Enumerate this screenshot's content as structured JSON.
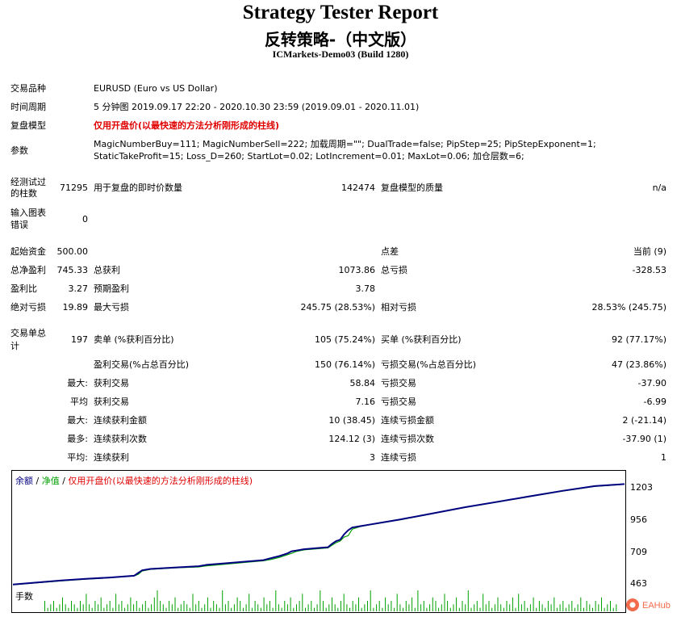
{
  "header": {
    "title": "Strategy Tester Report",
    "subtitle": "反转策略-（中文版）",
    "server": "ICMarkets-Demo03 (Build 1280)"
  },
  "settings": {
    "symbol_label": "交易品种",
    "symbol_value": "EURUSD (Euro vs US Dollar)",
    "period_label": "时间周期",
    "period_value": "5 分钟图 2019.09.17 22:20 - 2020.10.30 23:59 (2019.09.01 - 2020.11.01)",
    "model_label": "复盘模型",
    "model_value": "仅用开盘价(以最快速的方法分析刚形成的柱线)",
    "params_label": "参数",
    "params_line1": "MagicNumberBuy=111; MagicNumberSell=222; 加载周期=\"\"; DualTrade=false; PipStep=25; PipStepExponent=1;",
    "params_line2": "StaticTakeProfit=15; Loss_D=260; StartLot=0.02; LotIncrement=0.01; MaxLot=0.06; 加仓层数=6;"
  },
  "test_info": {
    "bars_label_1": "经测试过",
    "bars_label_2": "的柱数",
    "bars_value": "71295",
    "ticks_label": "用于复盘的即时价数量",
    "ticks_value": "142474",
    "quality_label": "复盘模型的质量",
    "quality_value": "n/a",
    "errors_label_1": "输入图表",
    "errors_label_2": "错误",
    "errors_value": "0"
  },
  "results": {
    "initial_deposit_label": "起始资金",
    "initial_deposit_value": "500.00",
    "spread_label": "点差",
    "spread_value": "当前 (9)",
    "net_profit_label": "总净盈利",
    "net_profit_value": "745.33",
    "gross_profit_label": "总获利",
    "gross_profit_value": "1073.86",
    "gross_loss_label": "总亏损",
    "gross_loss_value": "-328.53",
    "profit_factor_label": "盈利比",
    "profit_factor_value": "3.27",
    "expected_payoff_label": "预期盈利",
    "expected_payoff_value": "3.78",
    "abs_drawdown_label": "绝对亏损",
    "abs_drawdown_value": "19.89",
    "max_drawdown_label": "最大亏损",
    "max_drawdown_value": "245.75 (28.53%)",
    "rel_drawdown_label": "相对亏损",
    "rel_drawdown_value": "28.53% (245.75)"
  },
  "trades": {
    "total_label_1": "交易单总",
    "total_label_2": "计",
    "total_value": "197",
    "short_label": "卖单 (%获利百分比)",
    "short_value": "105 (75.24%)",
    "long_label": "买单 (%获利百分比)",
    "long_value": "92 (77.17%)",
    "profit_trades_label": "盈利交易(%占总百分比)",
    "profit_trades_value": "150 (76.14%)",
    "loss_trades_label": "亏损交易(%占总百分比)",
    "loss_trades_value": "47 (23.86%)",
    "largest_label": "最大:",
    "largest_profit_label": "获利交易",
    "largest_profit_value": "58.84",
    "largest_loss_label": "亏损交易",
    "largest_loss_value": "-37.90",
    "average_label": "平均",
    "average_profit_label": "获利交易",
    "average_profit_value": "7.16",
    "average_loss_label": "亏损交易",
    "average_loss_value": "-6.99",
    "max_label": "最大:",
    "max_consec_wins_money_label": "连续获利金额",
    "max_consec_wins_money_value": "10 (38.45)",
    "max_consec_losses_money_label": "连续亏损金额",
    "max_consec_losses_money_value": "2 (-21.14)",
    "maximal_label": "最多:",
    "maximal_consec_profit_label": "连续获利次数",
    "maximal_consec_profit_value": "124.12 (3)",
    "maximal_consec_loss_label": "连续亏损次数",
    "maximal_consec_loss_value": "-37.90 (1)",
    "avg_consec_label": "平均:",
    "avg_consec_wins_label": "连续获利",
    "avg_consec_wins_value": "3",
    "avg_consec_losses_label": "连续亏损",
    "avg_consec_losses_value": "1"
  },
  "chart_data": {
    "type": "line",
    "legend": {
      "balance": "余额",
      "sep1": " / ",
      "equity": "净值",
      "sep2": " / ",
      "model": "仅用开盘价(以最快速的方法分析刚形成的柱线)"
    },
    "colors": {
      "balance": "#000080",
      "equity": "#00a000",
      "model": "#e00000",
      "volume": "#00a000"
    },
    "ylim": [
      463,
      1260
    ],
    "yticks": [
      "1203",
      "956",
      "709",
      "463"
    ],
    "volume_label": "手数",
    "series": [
      {
        "name": "余额",
        "x": [
          0,
          30,
          60,
          90,
          120,
          150,
          155,
          160,
          170,
          200,
          230,
          240,
          260,
          290,
          310,
          320,
          330,
          340,
          345,
          350,
          360,
          380,
          390,
          395,
          400,
          405,
          410,
          415,
          420,
          430,
          440,
          480,
          520,
          560,
          600,
          640,
          680,
          720,
          757
        ],
        "y": [
          470,
          485,
          500,
          512,
          522,
          535,
          555,
          575,
          585,
          595,
          605,
          615,
          625,
          640,
          650,
          665,
          680,
          700,
          715,
          720,
          730,
          740,
          745,
          770,
          790,
          800,
          840,
          870,
          890,
          900,
          910,
          950,
          995,
          1040,
          1080,
          1120,
          1160,
          1195,
          1210
        ]
      },
      {
        "name": "净值",
        "x": [
          0,
          30,
          60,
          90,
          120,
          150,
          155,
          160,
          170,
          200,
          230,
          240,
          260,
          290,
          310,
          320,
          330,
          340,
          345,
          350,
          360,
          380,
          390,
          395,
          400,
          405,
          410,
          415,
          420,
          430,
          440,
          480,
          520,
          560,
          600,
          640,
          680,
          720,
          757
        ],
        "y": [
          468,
          483,
          497,
          510,
          520,
          533,
          545,
          570,
          582,
          593,
          600,
          608,
          618,
          635,
          645,
          655,
          670,
          690,
          700,
          712,
          725,
          735,
          740,
          760,
          778,
          790,
          820,
          830,
          878,
          898,
          908,
          948,
          993,
          1038,
          1078,
          1118,
          1158,
          1193,
          1208
        ]
      }
    ],
    "volume": [
      3,
      1,
      2,
      3,
      1,
      2,
      4,
      2,
      1,
      3,
      2,
      1,
      3,
      2,
      5,
      2,
      1,
      3,
      2,
      4,
      1,
      2,
      3,
      1,
      5,
      2,
      3,
      1,
      2,
      4,
      2,
      3,
      1,
      2,
      3,
      1,
      2,
      4,
      6,
      3,
      2,
      1,
      3,
      2,
      4,
      1,
      2,
      3,
      2,
      1,
      5,
      2,
      3,
      1,
      2,
      4,
      1,
      3,
      2,
      1,
      6,
      2,
      3,
      1,
      2,
      4,
      3,
      1,
      2,
      5,
      1,
      3,
      2,
      1,
      4,
      2,
      3,
      1,
      6,
      2,
      1,
      3,
      2,
      4,
      1,
      2,
      3,
      5,
      1,
      2,
      3,
      1,
      2,
      6,
      3,
      1,
      2,
      4,
      2,
      1,
      3,
      5,
      2,
      1,
      3,
      2,
      4,
      1,
      2,
      3,
      6,
      1,
      2,
      3,
      1,
      4,
      2,
      3,
      1,
      5,
      2,
      1,
      3,
      2,
      4,
      1,
      6,
      2,
      3,
      1,
      2,
      4,
      3,
      1,
      2,
      5,
      3,
      1,
      2,
      4,
      1,
      3,
      2,
      6,
      1,
      2,
      3,
      1,
      5,
      2,
      3,
      1,
      2,
      4,
      2,
      1,
      3,
      2,
      4,
      1,
      5,
      2,
      3,
      1,
      2,
      4,
      1,
      3,
      2,
      1,
      3,
      2,
      4,
      1,
      2,
      3,
      1,
      2,
      3,
      1,
      2,
      4,
      1,
      3,
      2,
      1,
      3,
      2,
      4,
      1,
      2,
      3,
      1,
      2
    ]
  },
  "watermark": "EAHub"
}
